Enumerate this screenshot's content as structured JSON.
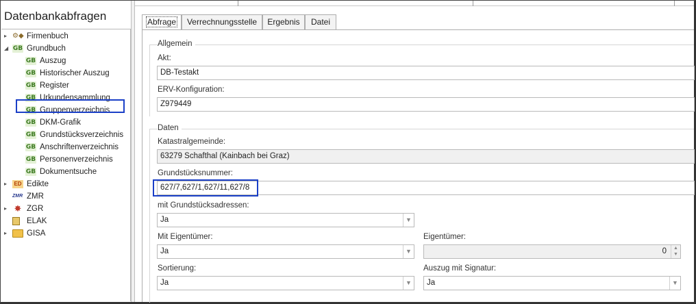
{
  "left_panel": {
    "title": "Datenbankabfragen",
    "tree": [
      {
        "label": "Firmenbuch",
        "icon": "firmenbuch-icon",
        "expander": "▸",
        "level": 0
      },
      {
        "label": "Grundbuch",
        "icon": "gb-icon",
        "expander": "◢",
        "level": 0,
        "icon_text": "GB"
      },
      {
        "label": "Auszug",
        "icon": "gb-icon",
        "level": 1,
        "icon_text": "GB"
      },
      {
        "label": "Historischer Auszug",
        "icon": "gb-icon",
        "level": 1,
        "icon_text": "GB"
      },
      {
        "label": "Register",
        "icon": "gb-icon",
        "level": 1,
        "icon_text": "GB"
      },
      {
        "label": "Urkundensammlung",
        "icon": "gb-icon",
        "level": 1,
        "icon_text": "GB"
      },
      {
        "label": "Gruppenverzeichnis",
        "icon": "gb-icon",
        "level": 1,
        "icon_text": "GB"
      },
      {
        "label": "DKM-Grafik",
        "icon": "gb-icon",
        "level": 1,
        "icon_text": "GB"
      },
      {
        "label": "Grundstücksverzeichnis",
        "icon": "gb-icon",
        "level": 1,
        "icon_text": "GB",
        "selected": true
      },
      {
        "label": "Anschriftenverzeichnis",
        "icon": "gb-icon",
        "level": 1,
        "icon_text": "GB"
      },
      {
        "label": "Personenverzeichnis",
        "icon": "gb-icon",
        "level": 1,
        "icon_text": "GB"
      },
      {
        "label": "Dokumentsuche",
        "icon": "gb-icon",
        "level": 1,
        "icon_text": "GB"
      },
      {
        "label": "Edikte",
        "icon": "edikte-icon",
        "expander": "▸",
        "level": 0,
        "icon_text": "ED"
      },
      {
        "label": "ZMR",
        "icon": "zmr-icon",
        "level": 0,
        "icon_text": "ZMR"
      },
      {
        "label": "ZGR",
        "icon": "zgr-icon",
        "expander": "▸",
        "level": 0
      },
      {
        "label": "ELAK",
        "icon": "elak-icon",
        "level": 0
      },
      {
        "label": "GISA",
        "icon": "folder-icon",
        "expander": "▸",
        "level": 0
      }
    ]
  },
  "tabs": [
    {
      "label": "Abfrage",
      "active": true
    },
    {
      "label": "Verrechnungsstelle",
      "active": false
    },
    {
      "label": "Ergebnis",
      "active": false
    },
    {
      "label": "Datei",
      "active": false
    }
  ],
  "allgemein": {
    "title": "Allgemein",
    "akt_label": "Akt:",
    "akt_value": "DB-Testakt",
    "erv_label": "ERV-Konfiguration:",
    "erv_value": "Z979449"
  },
  "daten": {
    "title": "Daten",
    "kg_label": "Katastralgemeinde:",
    "kg_value": "63279 Schafthal (Kainbach bei Graz)",
    "gst_label": "Grundstücksnummer:",
    "gst_value": "627/7,627/1,627/11,627/8",
    "adr_label": "mit Grundstücksadressen:",
    "adr_value": "Ja",
    "eig_label": "Mit Eigentümer:",
    "eig_value": "Ja",
    "eigt_label": "Eigentümer:",
    "eigt_value": "0",
    "sort_label": "Sortierung:",
    "sort_value": "Ja",
    "sig_label": "Auszug mit Signatur:",
    "sig_value": "Ja"
  },
  "colors": {
    "highlight": "#1a3fc7",
    "gb_green": "#3b7a20"
  }
}
